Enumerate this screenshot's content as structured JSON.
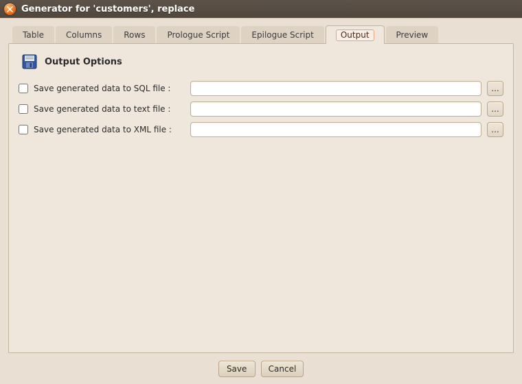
{
  "window": {
    "title": "Generator for 'customers', replace"
  },
  "tabs": [
    {
      "label": "Table"
    },
    {
      "label": "Columns"
    },
    {
      "label": "Rows"
    },
    {
      "label": "Prologue Script"
    },
    {
      "label": "Epilogue Script"
    },
    {
      "label": "Output"
    },
    {
      "label": "Preview"
    }
  ],
  "section": {
    "title": "Output Options"
  },
  "rows": {
    "sql": {
      "label": "Save generated data to SQL file :",
      "value": "",
      "browse": "..."
    },
    "text": {
      "label": "Save generated data to text file :",
      "value": "",
      "browse": "..."
    },
    "xml": {
      "label": "Save generated data to XML file :",
      "value": "",
      "browse": "..."
    }
  },
  "buttons": {
    "save": "Save",
    "cancel": "Cancel"
  }
}
